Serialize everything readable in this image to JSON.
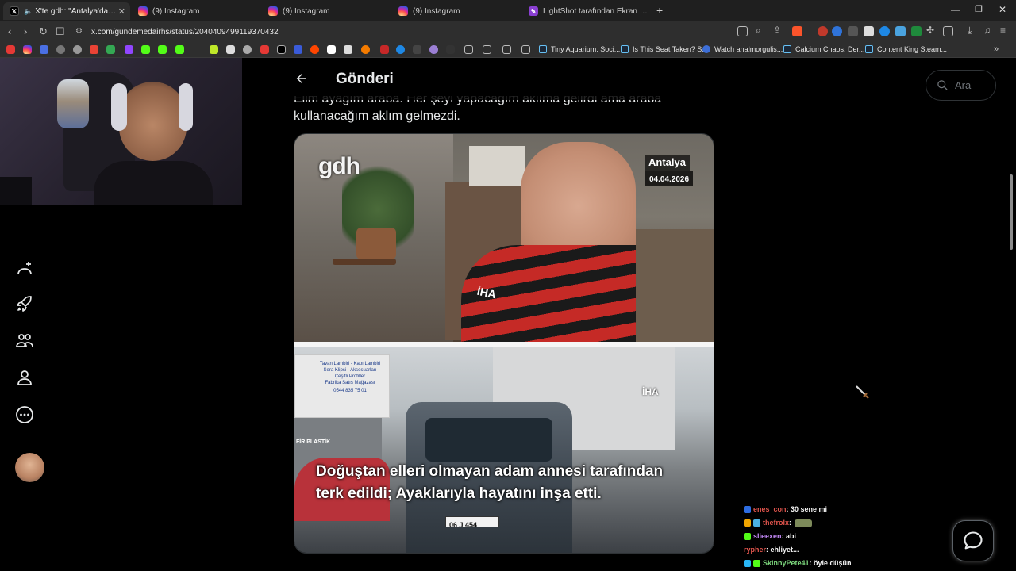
{
  "browser": {
    "tabs": [
      {
        "title": "X'te gdh: \"Antalya'da doğuştan",
        "active": true
      },
      {
        "title": "(9) Instagram",
        "active": false
      },
      {
        "title": "(9) Instagram",
        "active": false
      },
      {
        "title": "(9) Instagram",
        "active": false
      },
      {
        "title": "LightShot tarafından Ekran Görüntüsü",
        "active": false
      }
    ],
    "new_tab": "+",
    "url": "x.com/gundemedairhs/status/2040409499119370432",
    "bookmarks": [
      {
        "label": "Tiny Aquarium: Soci..."
      },
      {
        "label": "Is This Seat Taken? S..."
      },
      {
        "label": "Watch analmorgulis..."
      },
      {
        "label": "Calcium Chaos: Der..."
      },
      {
        "label": "Content King Steam..."
      }
    ]
  },
  "post": {
    "header_title": "Gönderi",
    "text_line1": "Elim ayağım araba. Her şeyi yapacağım aklıma gelirdi ama araba",
    "text_line2": "kullanacağım aklım gelmezdi.",
    "media": {
      "logo": "gdh",
      "location": "Antalya",
      "date": "04.04.2026",
      "agency": "İHA",
      "sign_line1": "Tavan Lambiri - Kapı Lambiri",
      "sign_line2": "Sera Klipsi - Aksesuarları",
      "sign_line3": "Çeşitli Profiller",
      "sign_line4": "Fabrika Satış Mağazası",
      "sign_phone": "0544 835 75 01",
      "store_name": "FİR PLASTİK",
      "plate": "06 J 454",
      "caption_line1": "Doğuştan elleri olmayan adam annesi tarafından",
      "caption_line2": "terk edildi; Ayaklarıyla hayatını inşa etti."
    }
  },
  "search": {
    "placeholder": "Ara"
  },
  "chat": [
    {
      "user": "enes_con",
      "msg": ": 30 sene mi",
      "color": "#e0544c"
    },
    {
      "user": "thefrolx",
      "msg": ":",
      "color": "#e0544c"
    },
    {
      "user": "slieexen",
      "msg": ": abi",
      "color": "#c58af9"
    },
    {
      "user": "rypher",
      "msg": ": ehliyet...",
      "color": "#e0544c"
    },
    {
      "user": "SkinnyPete41",
      "msg": ": öyle düşün",
      "color": "#7dd87d"
    }
  ]
}
